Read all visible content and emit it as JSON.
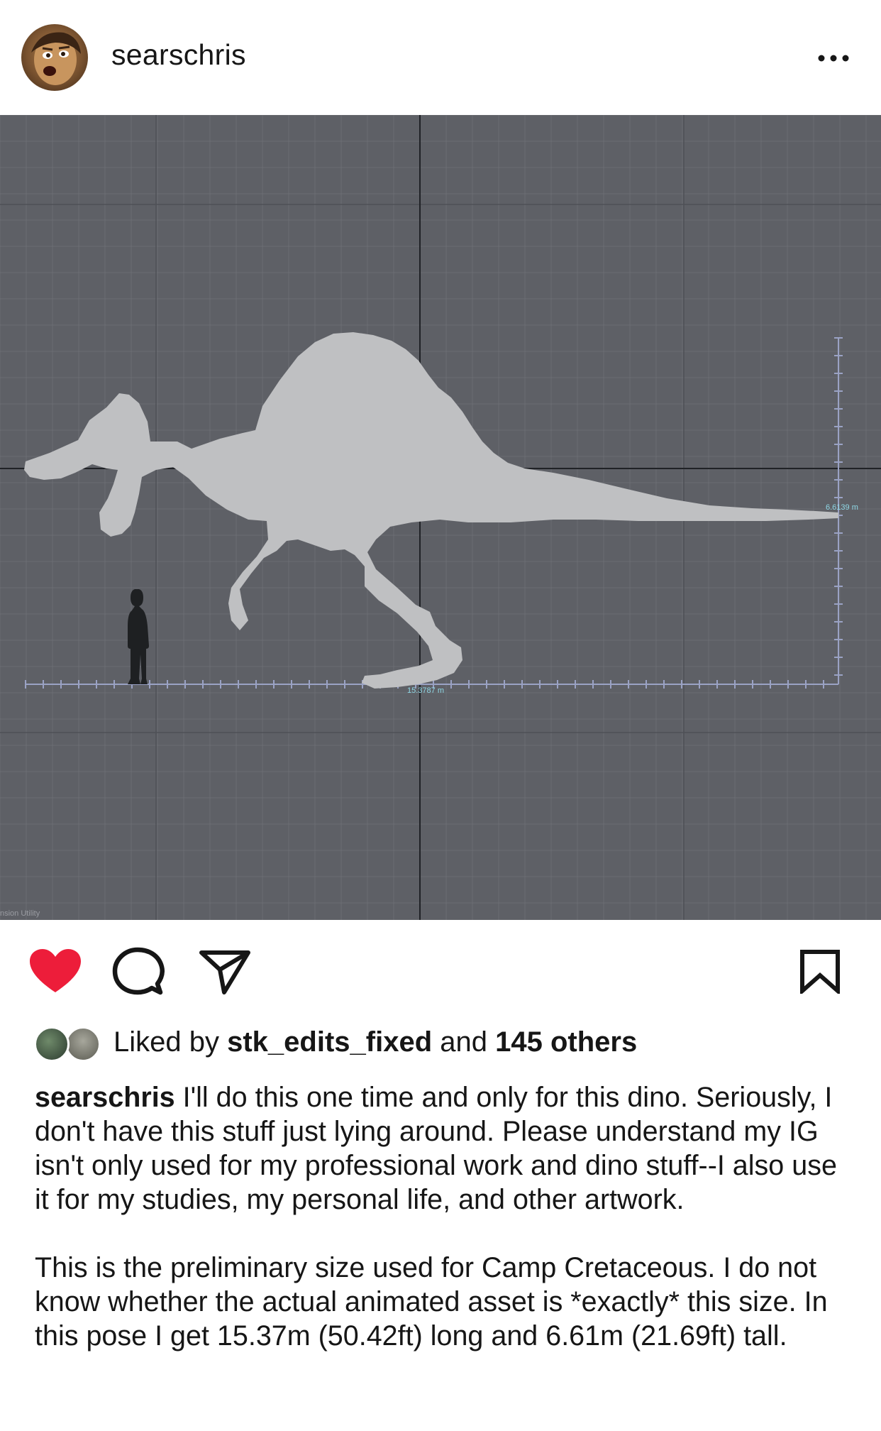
{
  "post": {
    "username": "searschris",
    "more_icon": "ellipsis-icon"
  },
  "image": {
    "measure_height": "6.6139 m",
    "measure_length": "15.3787 m",
    "viewport_label": "nsion Utility",
    "grid_color": "#5e6066",
    "silhouette_color": "#bfc0c2"
  },
  "actions": {
    "like_icon": "heart-filled-icon",
    "like_color": "#ed1d3a",
    "comment_icon": "comment-bubble-icon",
    "share_icon": "paper-plane-icon",
    "save_icon": "bookmark-icon"
  },
  "likes": {
    "prefix": "Liked by ",
    "first_liker": "stk_edits_fixed",
    "middle": " and ",
    "others": "145 others"
  },
  "caption": {
    "username": "searschris",
    "paragraph1": " I'll do this one time and only for this dino. Seriously, I don't have this stuff just lying around.  Please understand my IG isn't only used for my professional work and dino stuff--I also use it for my studies, my personal life, and other artwork.",
    "paragraph2": "This is the preliminary size used for Camp Cretaceous.  I do not know whether the actual animated asset is *exactly* this size.  In this pose I get 15.37m (50.42ft) long and 6.61m (21.69ft) tall."
  }
}
